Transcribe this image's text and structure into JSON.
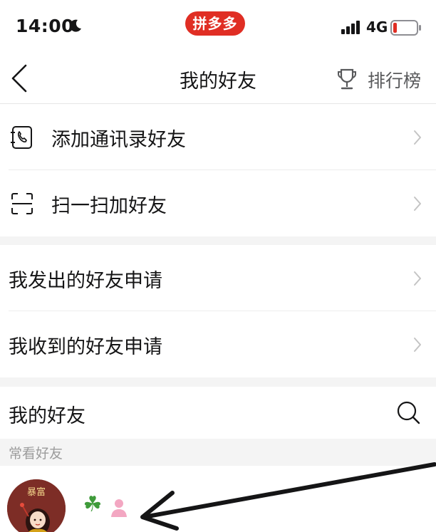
{
  "status_bar": {
    "time": "14:00",
    "app_badge": "拼多多",
    "network": "4G",
    "icons": [
      "moon-icon",
      "signal-icon",
      "battery-icon"
    ]
  },
  "nav": {
    "title": "我的好友",
    "rank_label": "排行榜",
    "icons": [
      "back-icon",
      "trophy-icon"
    ]
  },
  "menu": {
    "add_contacts": "添加通讯录好友",
    "scan_add": "扫一扫加好友",
    "sent_requests": "我发出的好友申请",
    "received_requests": "我收到的好友申请"
  },
  "friends": {
    "title": "我的好友",
    "frequent_label": "常看好友",
    "first_friend_avatar_text": "暴富"
  },
  "colors": {
    "brand_red": "#e02e24",
    "section_gap": "#f4f4f4",
    "secondary_text": "#9c9c9c"
  }
}
